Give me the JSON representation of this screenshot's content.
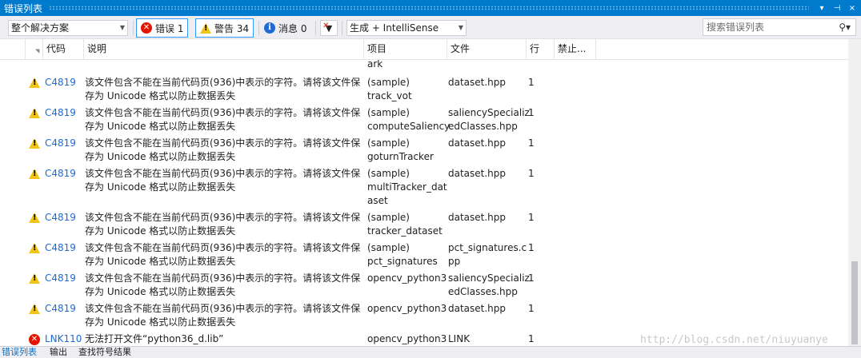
{
  "window": {
    "title": "错误列表",
    "buttons": [
      "▾",
      "⊣",
      "×"
    ]
  },
  "toolbar": {
    "scope": "整个解决方案",
    "errors_label": "错误 1",
    "warnings_label": "警告 34",
    "messages_label": "消息 0",
    "build_source": "生成 + IntelliSense",
    "search_placeholder": "搜索错误列表"
  },
  "columns": {
    "code": "代码",
    "description": "说明",
    "project": "项目",
    "file": "文件",
    "line": "行",
    "suppression": "禁止..."
  },
  "rows": [
    {
      "type": "continuation",
      "code": "",
      "desc": "",
      "project": "ark",
      "file": "",
      "line": ""
    },
    {
      "type": "warning",
      "code": "C4819",
      "desc": "该文件包含不能在当前代码页(936)中表示的字符。请将该文件保\n存为 Unicode 格式以防止数据丢失",
      "project": "(sample)\ntrack_vot",
      "file": "dataset.hpp",
      "line": "1"
    },
    {
      "type": "warning",
      "code": "C4819",
      "desc": "该文件包含不能在当前代码页(936)中表示的字符。请将该文件保\n存为 Unicode 格式以防止数据丢失",
      "project": "(sample)\ncomputeSaliency",
      "file": "saliencySpecializ\nedClasses.hpp",
      "line": "1"
    },
    {
      "type": "warning",
      "code": "C4819",
      "desc": "该文件包含不能在当前代码页(936)中表示的字符。请将该文件保\n存为 Unicode 格式以防止数据丢失",
      "project": "(sample)\ngoturnTracker",
      "file": "dataset.hpp",
      "line": "1"
    },
    {
      "type": "warning",
      "code": "C4819",
      "desc": "该文件包含不能在当前代码页(936)中表示的字符。请将该文件保\n存为 Unicode 格式以防止数据丢失",
      "project": "(sample)\nmultiTracker_dat\naset",
      "file": "dataset.hpp",
      "line": "1"
    },
    {
      "type": "warning",
      "code": "C4819",
      "desc": "该文件包含不能在当前代码页(936)中表示的字符。请将该文件保\n存为 Unicode 格式以防止数据丢失",
      "project": "(sample)\ntracker_dataset",
      "file": "dataset.hpp",
      "line": "1"
    },
    {
      "type": "warning",
      "code": "C4819",
      "desc": "该文件包含不能在当前代码页(936)中表示的字符。请将该文件保\n存为 Unicode 格式以防止数据丢失",
      "project": "(sample)\npct_signatures",
      "file": "pct_signatures.c\npp",
      "line": "1"
    },
    {
      "type": "warning",
      "code": "C4819",
      "desc": "该文件包含不能在当前代码页(936)中表示的字符。请将该文件保\n存为 Unicode 格式以防止数据丢失",
      "project": "opencv_python3",
      "file": "saliencySpecializ\nedClasses.hpp",
      "line": "1"
    },
    {
      "type": "warning",
      "code": "C4819",
      "desc": "该文件包含不能在当前代码页(936)中表示的字符。请将该文件保\n存为 Unicode 格式以防止数据丢失",
      "project": "opencv_python3",
      "file": "dataset.hpp",
      "line": "1"
    },
    {
      "type": "error",
      "code": "LNK110",
      "desc": "无法打开文件“python36_d.lib”",
      "project": "opencv_python3",
      "file": "LINK",
      "line": "1"
    }
  ],
  "bottom_tabs": [
    "错误列表",
    "输出",
    "查找符号结果"
  ],
  "watermark": "http://blog.csdn.net/niuyuanye",
  "colors": {
    "accent": "#007acc",
    "error": "#e51400",
    "warning": "#f0c419",
    "info": "#1e6bd6",
    "code_link": "#1a6ad8"
  }
}
